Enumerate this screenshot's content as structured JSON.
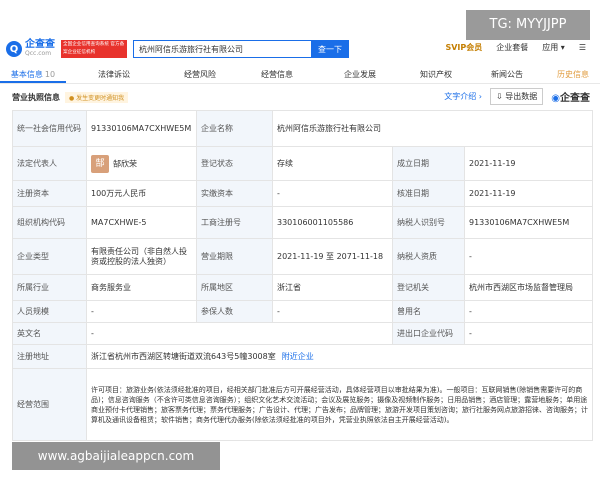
{
  "watermark_top": "TG: MYYJJPP",
  "watermark_bottom": "www.agbaijialeappcn.com",
  "header": {
    "logo_mark": "Q",
    "logo_name": "企查查",
    "logo_domain": "Qcc.com",
    "badge_text": "全国企业信用查询系统 官方备案企业征信机构",
    "search_value": "杭州阿信乐游旅行社有限公司",
    "search_button": "查一下",
    "svip": "SVIP会员",
    "package": "企业套餐",
    "apps": "应用 ▾",
    "menu_icon": "menu-icon",
    "accent": "#1a6ee8"
  },
  "tabs": [
    {
      "label": "基本信息",
      "count": "10"
    },
    {
      "label": "法律诉讼",
      "count": ""
    },
    {
      "label": "经营风险",
      "count": ""
    },
    {
      "label": "经营信息",
      "count": ""
    },
    {
      "label": "企业发展",
      "count": ""
    },
    {
      "label": "知识产权",
      "count": ""
    },
    {
      "label": "新闻公告",
      "count": ""
    },
    {
      "label": "历史信息",
      "count": ""
    }
  ],
  "section": {
    "title": "营业执照信息",
    "tag": "● 发生变更时通知我",
    "text_intro": "文字介绍 ›",
    "export": "导出数据",
    "brand": "企查查"
  },
  "info": {
    "credit_code_label": "统一社会信用代码",
    "credit_code": "91330106MA7CXHWE5M",
    "company_name_label": "企业名称",
    "company_name": "杭州阿信乐游旅行社有限公司",
    "legal_rep_label": "法定代表人",
    "legal_rep_avatar": "郜",
    "legal_rep": "郜欣荣",
    "reg_status_label": "登记状态",
    "reg_status": "存续",
    "founded_label": "成立日期",
    "founded": "2021-11-19",
    "reg_capital_label": "注册资本",
    "reg_capital": "100万元人民币",
    "paid_capital_label": "实缴资本",
    "paid_capital": "-",
    "approval_label": "核准日期",
    "approval": "2021-11-19",
    "org_code_label": "组织机构代码",
    "org_code": "MA7CXHWE-5",
    "biz_reg_no_label": "工商注册号",
    "biz_reg_no": "330106001105586",
    "taxpayer_id_label": "纳税人识别号",
    "taxpayer_id": "91330106MA7CXHWE5M",
    "type_label": "企业类型",
    "type": "有限责任公司（非自然人投资或控股的法人独资）",
    "term_label": "营业期限",
    "term": "2021-11-19 至 2071-11-18",
    "taxpayer_q_label": "纳税人资质",
    "taxpayer_q": "-",
    "industry_label": "所属行业",
    "industry": "商务服务业",
    "region_label": "所属地区",
    "region": "浙江省",
    "authority_label": "登记机关",
    "authority": "杭州市西湖区市场监督管理局",
    "staff_label": "人员规模",
    "staff": "-",
    "insured_label": "参保人数",
    "insured": "-",
    "former_name_label": "曾用名",
    "former_name": "-",
    "english_label": "英文名",
    "english": "-",
    "ie_code_label": "进出口企业代码",
    "ie_code": "-",
    "address_label": "注册地址",
    "address": "浙江省杭州市西湖区转塘街道双流643号5幢3008室",
    "nearby": "附近企业",
    "scope_label": "经营范围",
    "scope": "许可项目：旅游业务(依法须经批准的项目，经相关部门批准后方可开展经营活动，具体经营项目以审批结果为准)。一般项目：互联网销售(除销售需要许可的商品)；信息咨询服务（不含许可类信息咨询服务）；组织文化艺术交流活动；会议及展览服务；摄像及视频制作服务；日用品销售；酒店管理；露营地服务；单用途商业预付卡代理销售；旅客票务代理；票务代理服务；广告设计、代理；广告发布；品牌管理；旅游开发项目策划咨询；旅行社服务网点旅游招徕、咨询服务；计算机及通讯设备租赁；软件销售；商务代理代办服务(除依法须经批准的项目外，凭营业执照依法自主开展经营活动)。"
  }
}
